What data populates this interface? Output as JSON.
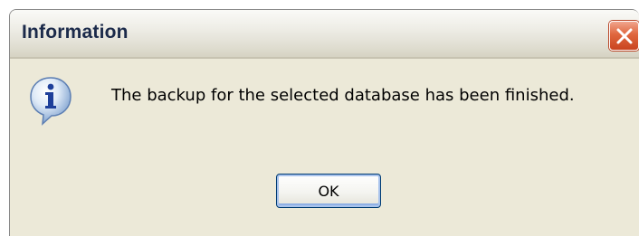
{
  "window": {
    "title": "Information",
    "close_icon": "close-icon"
  },
  "dialog": {
    "icon": "info-icon",
    "message": "The backup for the selected database has been finished.",
    "ok_label": "OK"
  },
  "colors": {
    "dialog_background": "#ece9d8",
    "close_button": "#e0673f",
    "button_focus_border": "#003c74"
  }
}
